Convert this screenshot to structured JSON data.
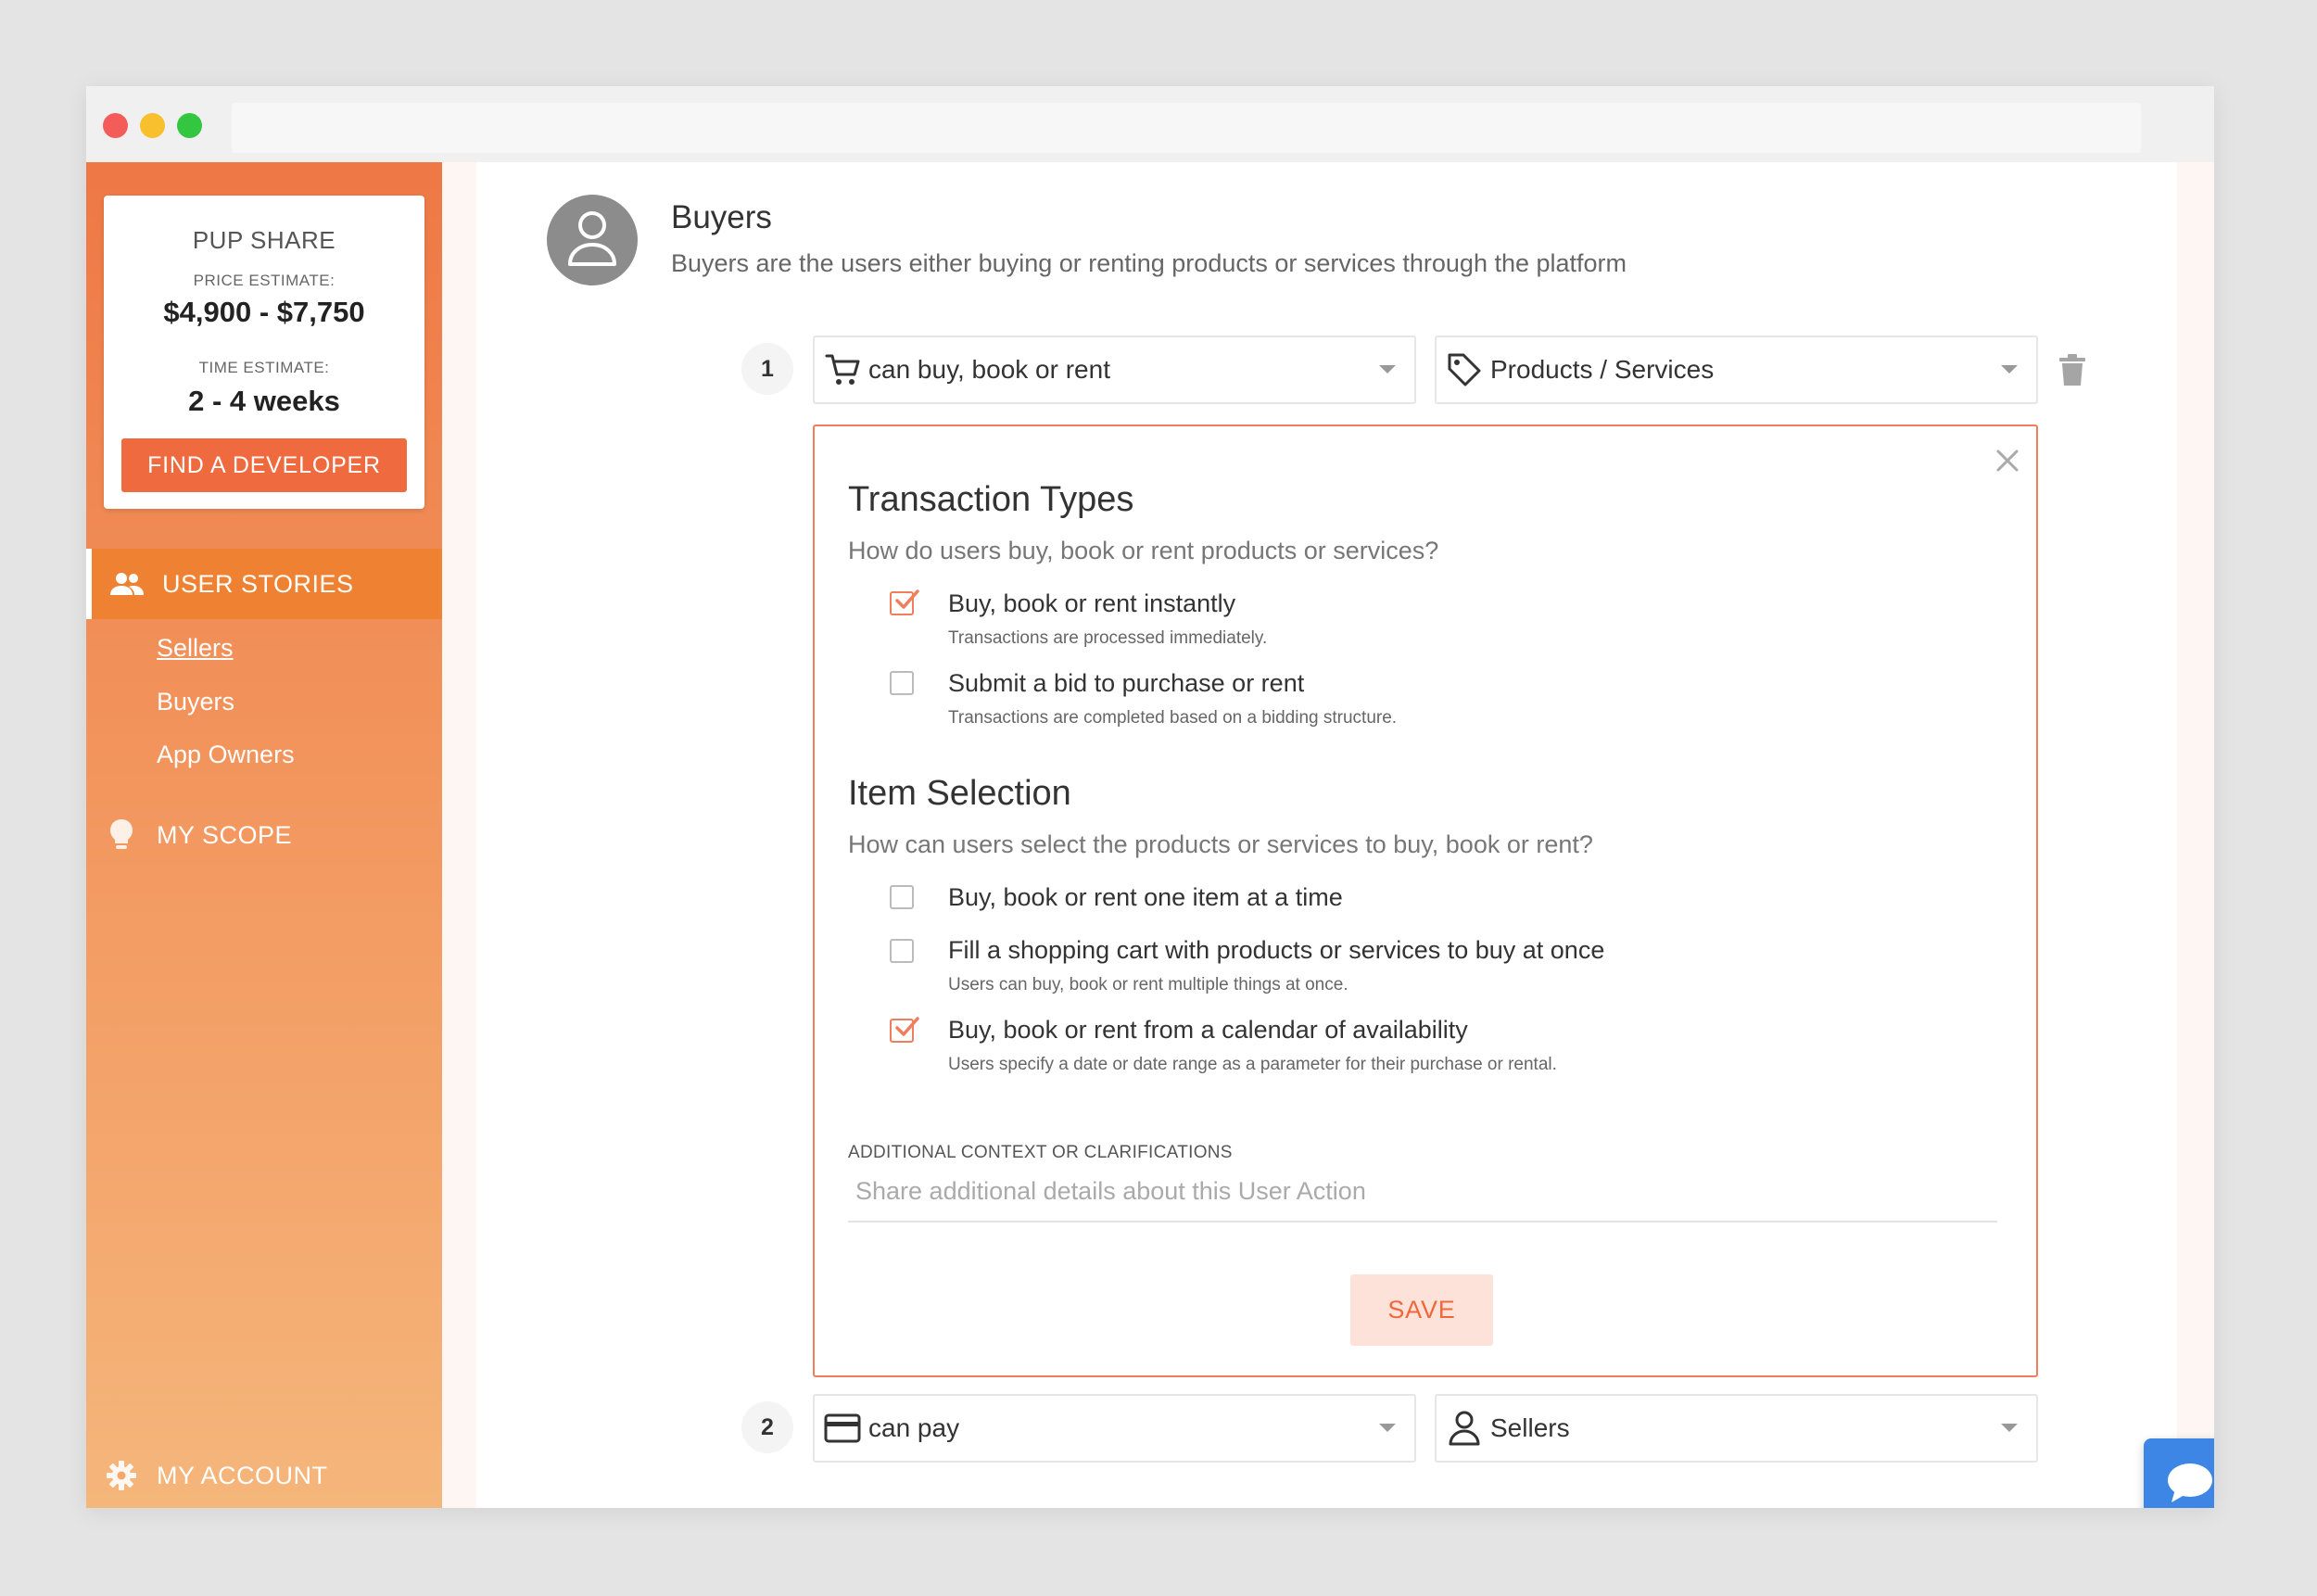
{
  "estimate": {
    "project_name": "PUP SHARE",
    "price_label": "PRICE ESTIMATE:",
    "price_value": "$4,900 - $7,750",
    "time_label": "TIME ESTIMATE:",
    "time_value": "2 - 4 weeks",
    "find_developer": "FIND A DEVELOPER"
  },
  "sidebar": {
    "user_stories": "USER STORIES",
    "stories": [
      {
        "label": "Sellers"
      },
      {
        "label": "Buyers"
      },
      {
        "label": "App Owners"
      }
    ],
    "my_scope": "MY SCOPE",
    "my_account": "MY ACCOUNT"
  },
  "role": {
    "title": "Buyers",
    "description": "Buyers are the users either buying or renting products or services through the platform"
  },
  "actions": [
    {
      "number": "1",
      "action": "can buy, book or rent",
      "object": "Products / Services"
    },
    {
      "number": "2",
      "action": "can pay",
      "object": "Sellers"
    }
  ],
  "panel": {
    "transaction": {
      "title": "Transaction Types",
      "question": "How do users buy, book or rent products or services?",
      "options": [
        {
          "label": "Buy, book or rent instantly",
          "help": "Transactions are processed immediately.",
          "checked": true
        },
        {
          "label": "Submit a bid to purchase or rent",
          "help": "Transactions are completed based on a bidding structure.",
          "checked": false
        }
      ]
    },
    "selection": {
      "title": "Item Selection",
      "question": "How can users select the products or services to buy, book or rent?",
      "options": [
        {
          "label": "Buy, book or rent one item at a time",
          "help": "",
          "checked": false
        },
        {
          "label": "Fill a shopping cart with products or services to buy at once",
          "help": "Users can buy, book or rent multiple things at once.",
          "checked": false
        },
        {
          "label": "Buy, book or rent from a calendar of availability",
          "help": "Users specify a date or date range as a parameter for their purchase or rental.",
          "checked": true
        }
      ]
    },
    "context_label": "ADDITIONAL CONTEXT OR CLARIFICATIONS",
    "context_placeholder": "Share additional details about this User Action",
    "context_value": "",
    "save": "SAVE"
  },
  "colors": {
    "accent": "#ef6a3f",
    "accent_light": "#fde2da",
    "chat": "#3d86e6"
  },
  "icons": {
    "cart": "cart-icon",
    "tag": "tag-icon",
    "trash": "trash-icon",
    "close": "close-icon",
    "card": "credit-card-icon",
    "user": "user-icon",
    "users": "users-icon",
    "bulb": "lightbulb-icon",
    "gear": "gear-icon",
    "chat": "chat-bubble-icon"
  }
}
